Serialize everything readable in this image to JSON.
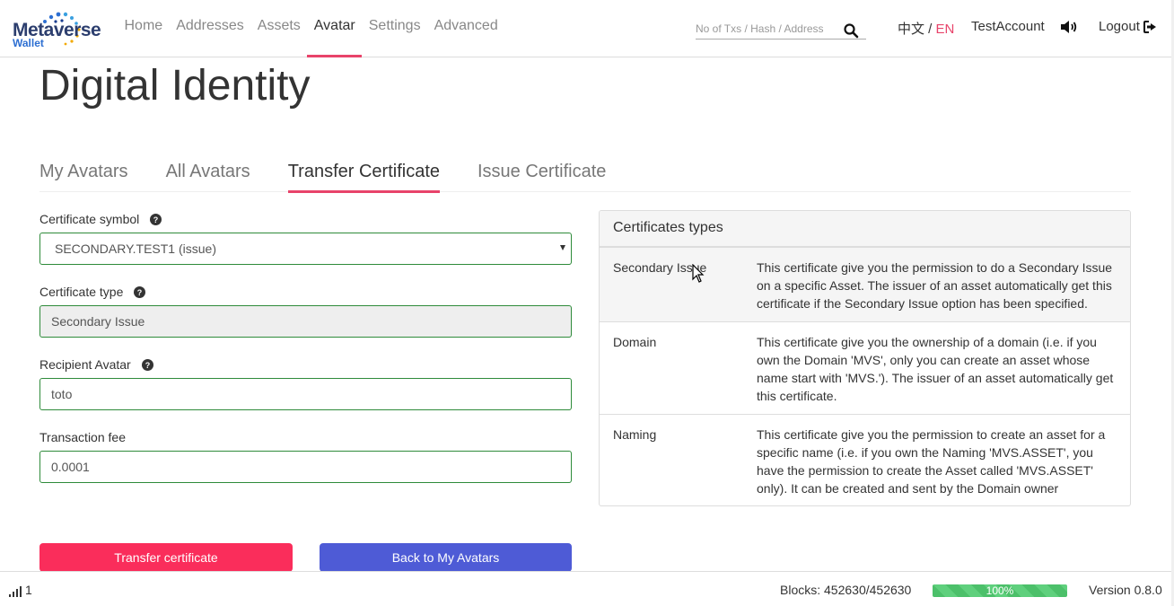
{
  "header": {
    "logo": {
      "title": "Metaverse",
      "subtitle": "Wallet"
    },
    "nav": [
      {
        "label": "Home",
        "active": false
      },
      {
        "label": "Addresses",
        "active": false
      },
      {
        "label": "Assets",
        "active": false
      },
      {
        "label": "Avatar",
        "active": true
      },
      {
        "label": "Settings",
        "active": false
      },
      {
        "label": "Advanced",
        "active": false
      }
    ],
    "search": {
      "placeholder": "No of Txs / Hash / Address",
      "value": ""
    },
    "lang_cn": "中文",
    "lang_sep": " / ",
    "lang_en": "EN",
    "account": "TestAccount",
    "logout": "Logout"
  },
  "page": {
    "title": "Digital Identity",
    "tabs": [
      {
        "label": "My Avatars",
        "active": false
      },
      {
        "label": "All Avatars",
        "active": false
      },
      {
        "label": "Transfer Certificate",
        "active": true
      },
      {
        "label": "Issue Certificate",
        "active": false
      }
    ]
  },
  "form": {
    "symbol_label": "Certificate symbol",
    "symbol_value": "SECONDARY.TEST1 (issue)",
    "type_label": "Certificate type",
    "type_value": "Secondary Issue",
    "recipient_label": "Recipient Avatar",
    "recipient_value": "toto",
    "fee_label": "Transaction fee",
    "fee_value": "0.0001",
    "submit_label": "Transfer certificate",
    "back_label": "Back to My Avatars"
  },
  "panel": {
    "title": "Certificates types",
    "rows": [
      {
        "name": "Secondary Issue",
        "desc": "This certificate give you the permission to do a Secondary Issue on a specific Asset. The issuer of an asset automatically get this certificate if the Secondary Issue option has been specified."
      },
      {
        "name": "Domain",
        "desc": "This certificate give you the ownership of a domain (i.e. if you own the Domain 'MVS', only you can create an asset whose name start with 'MVS.'). The issuer of an asset automatically get this certificate."
      },
      {
        "name": "Naming",
        "desc": "This certificate give you the permission to create an asset for a specific name (i.e. if you own the Naming 'MVS.ASSET', you have the permission to create the Asset called 'MVS.ASSET' only). It can be created and sent by the Domain owner"
      }
    ]
  },
  "footer": {
    "peers": "1",
    "blocks": "Blocks: 452630/452630",
    "progress_label": "100%",
    "progress_value": 1.0,
    "version": "Version 0.8.0"
  },
  "colors": {
    "accent": "#e8436a",
    "primary_button": "#fa2d5b",
    "secondary_button": "#4e5bd6",
    "input_border": "#2e8b3a",
    "progress": "#4cc06a"
  },
  "icons": [
    "logo-dots-icon",
    "search-icon",
    "question-circle-icon",
    "volume-icon",
    "sign-out-icon",
    "signal-bars-icon",
    "mouse-cursor-icon"
  ]
}
